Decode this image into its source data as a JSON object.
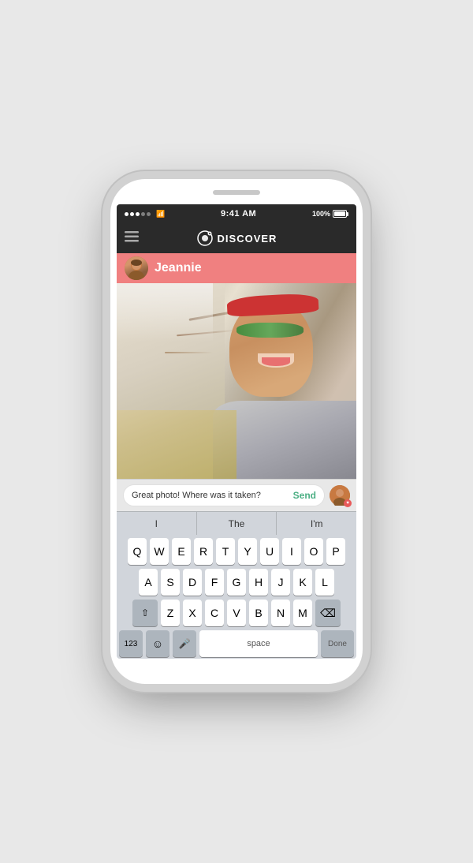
{
  "statusBar": {
    "time": "9:41 AM",
    "battery": "100%",
    "batteryIcon": "battery-full"
  },
  "navBar": {
    "logoAlt": "app-logo",
    "title": "DISCOVER",
    "backIcon": "menu-icon"
  },
  "userHeader": {
    "name": "Jeannie",
    "avatarAlt": "jeannie-avatar"
  },
  "messageInput": {
    "text": "Great photo! Where was it taken?",
    "sendLabel": "Send"
  },
  "predictive": {
    "items": [
      "I",
      "The",
      "I'm"
    ]
  },
  "keyboard": {
    "rows": [
      [
        "Q",
        "W",
        "E",
        "R",
        "T",
        "Y",
        "U",
        "I",
        "O",
        "P"
      ],
      [
        "A",
        "S",
        "D",
        "F",
        "G",
        "H",
        "J",
        "K",
        "L"
      ],
      [
        "Z",
        "X",
        "C",
        "V",
        "B",
        "N",
        "M"
      ]
    ],
    "specialKeys": {
      "shift": "⇧",
      "backspace": "⌫",
      "numbers": "123",
      "emoji": "☺",
      "mic": "🎤",
      "space": "space",
      "done": "Done"
    }
  }
}
